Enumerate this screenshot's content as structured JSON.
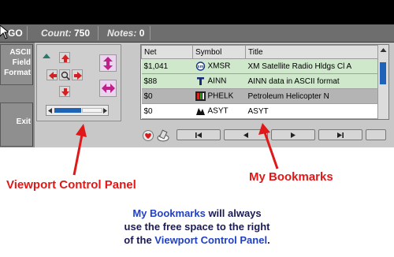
{
  "status_bar": {
    "go_label": "GO",
    "count_label": "Count:",
    "count_value": "750",
    "notes_label": "Notes:",
    "notes_value": "0"
  },
  "side_buttons": {
    "ascii_line1": "ASCII",
    "ascii_line2": "Field",
    "ascii_line3": "Format",
    "exit_label": "Exit"
  },
  "bookmarks": {
    "columns": [
      "Net",
      "Symbol",
      "Title"
    ],
    "rows": [
      {
        "net": "$1,041",
        "symbol": "XMSR",
        "title": "XM Satellite Radio Hldgs Cl A",
        "icon": "xm-logo-icon"
      },
      {
        "net": "$88",
        "symbol": "AINN",
        "title": "AINN data in ASCII format",
        "icon": "ainn-logo-icon"
      },
      {
        "net": "$0",
        "symbol": "PHELK",
        "title": "Petroleum Helicopter N",
        "icon": "phelk-logo-icon"
      },
      {
        "net": "$0",
        "symbol": "ASYT",
        "title": "ASYT",
        "icon": "asyt-logo-icon"
      }
    ]
  },
  "nav": {
    "buttons": [
      "first",
      "prev",
      "next",
      "last"
    ]
  },
  "annotations": {
    "viewport_label": "Viewport Control Panel",
    "bookmarks_label": "My Bookmarks",
    "caption_line1_bold": "My Bookmarks",
    "caption_line1_rest": " will always",
    "caption_line2": "use the free space to the right",
    "caption_line3_pre": "of the ",
    "caption_line3_bold": "Viewport Control Panel",
    "caption_line3_post": "."
  },
  "colors": {
    "accent_red": "#e01818",
    "accent_blue": "#2040c8",
    "selected_row": "#cfe8cc",
    "scroll_thumb": "#1e63b8"
  }
}
